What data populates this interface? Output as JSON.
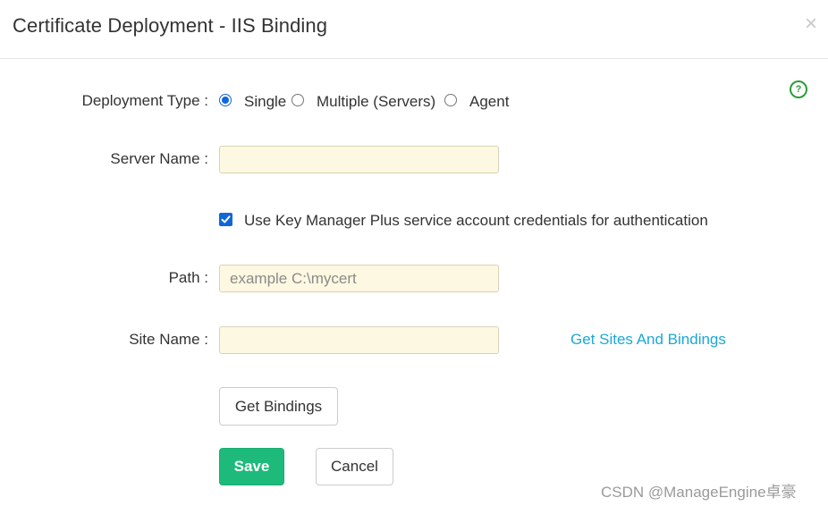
{
  "dialog": {
    "title": "Certificate Deployment - IIS Binding",
    "close_label": "×",
    "help_label": "?"
  },
  "form": {
    "deployment_type": {
      "label": "Deployment Type :",
      "options": [
        {
          "label": "Single",
          "checked": true
        },
        {
          "label": "Multiple (Servers)",
          "checked": false
        },
        {
          "label": "Agent",
          "checked": false
        }
      ]
    },
    "server_name": {
      "label": "Server Name :",
      "value": "",
      "placeholder": ""
    },
    "use_credentials": {
      "label": "Use Key Manager Plus service account credentials for authentication",
      "checked": true
    },
    "path": {
      "label": "Path :",
      "value": "",
      "placeholder": "example C:\\mycert"
    },
    "site_name": {
      "label": "Site Name :",
      "value": "",
      "placeholder": ""
    },
    "get_sites_link": "Get Sites And Bindings",
    "get_bindings_button": "Get Bindings",
    "save_button": "Save",
    "cancel_button": "Cancel"
  },
  "watermark": "CSDN @ManageEngine卓豪",
  "colors": {
    "radio_accent": "#0f67d9",
    "input_bg": "#fdf8e1",
    "link": "#1ba8d6",
    "save_bg": "#1dba7b",
    "help_icon": "#2a9c3a"
  }
}
